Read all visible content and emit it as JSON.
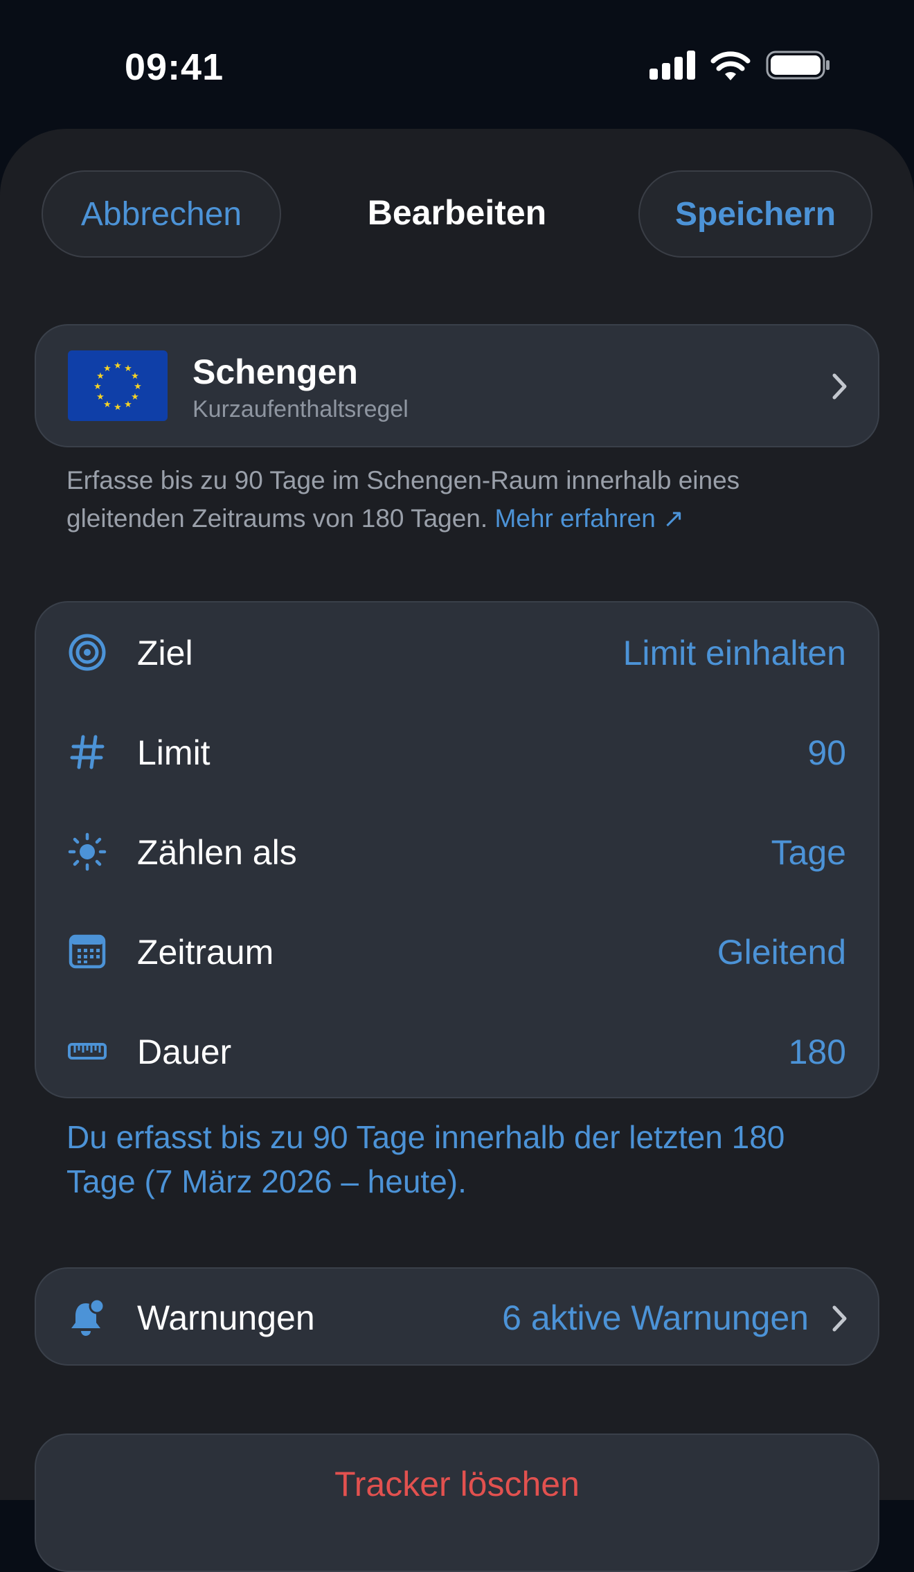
{
  "status_bar": {
    "time": "09:41"
  },
  "nav": {
    "cancel_label": "Abbrechen",
    "title": "Bearbeiten",
    "save_label": "Speichern"
  },
  "region": {
    "name": "Schengen",
    "subtitle": "Kurzaufenthaltsregel"
  },
  "description": {
    "text": "Erfasse bis zu 90 Tage im Schengen-Raum innerhalb eines gleitenden Zeitraums von 180 Tagen.",
    "link": "Mehr erfahren ↗"
  },
  "settings": [
    {
      "label": "Ziel",
      "value": "Limit einhalten",
      "icon": "target-icon"
    },
    {
      "label": "Limit",
      "value": "90",
      "icon": "hash-icon"
    },
    {
      "label": "Zählen als",
      "value": "Tage",
      "icon": "sun-icon"
    },
    {
      "label": "Zeitraum",
      "value": "Gleitend",
      "icon": "calendar-icon"
    },
    {
      "label": "Dauer",
      "value": "180",
      "icon": "ruler-icon"
    }
  ],
  "summary": "Du erfasst bis zu 90 Tage innerhalb der letzten 180 Tage (7 März 2026 – heute).",
  "warnings": {
    "label": "Warnungen",
    "value": "6 aktive Warnungen",
    "icon": "bell-badge-icon"
  },
  "delete_label": "Tracker löschen",
  "colors": {
    "accent": "#4c93d7",
    "destructive": "#e2514f",
    "sheet_bg": "#1c1e23",
    "card_bg": "#2c313a"
  }
}
